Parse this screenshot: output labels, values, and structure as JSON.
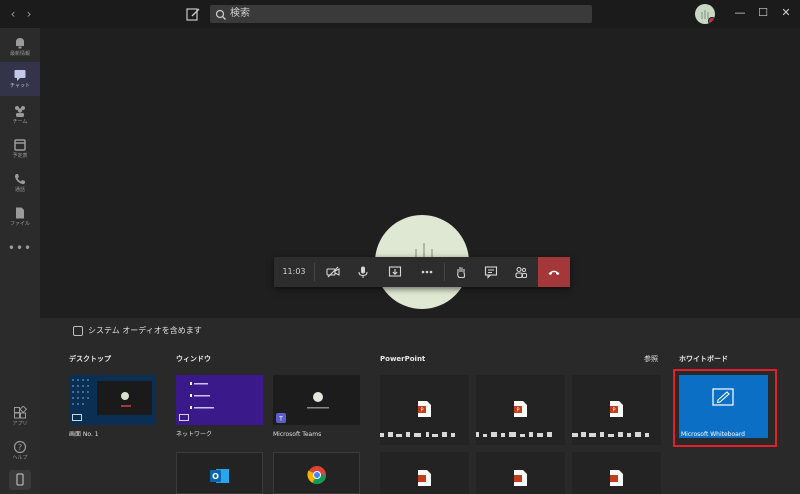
{
  "titlebar": {
    "search_placeholder": "検索"
  },
  "rail": {
    "items": [
      {
        "label": "最新情報",
        "icon": "bell-icon"
      },
      {
        "label": "チャット",
        "icon": "chat-icon"
      },
      {
        "label": "チーム",
        "icon": "teams-icon"
      },
      {
        "label": "予定表",
        "icon": "calendar-icon"
      },
      {
        "label": "通話",
        "icon": "phone-icon"
      },
      {
        "label": "ファイル",
        "icon": "file-icon"
      }
    ],
    "more": "•••",
    "apps_label": "アプリ",
    "help_label": "ヘルプ"
  },
  "controls": {
    "timer": "11:03"
  },
  "share": {
    "include_audio_label": "システム オーディオを含めます",
    "desktop_title": "デスクトップ",
    "window_title": "ウィンドウ",
    "powerpoint_title": "PowerPoint",
    "browse_label": "参照",
    "whiteboard_title": "ホワイトボード",
    "desktop_items": [
      {
        "label": "画面 No. 1"
      }
    ],
    "window_items": [
      {
        "label": "ネットワーク"
      },
      {
        "label": "Microsoft Teams"
      }
    ],
    "whiteboard_label": "Microsoft Whiteboard"
  },
  "colors": {
    "hangup": "#a4373a",
    "whiteboard": "#0b6fc6",
    "highlight": "#e3202a",
    "active_rail": "#33344a"
  }
}
